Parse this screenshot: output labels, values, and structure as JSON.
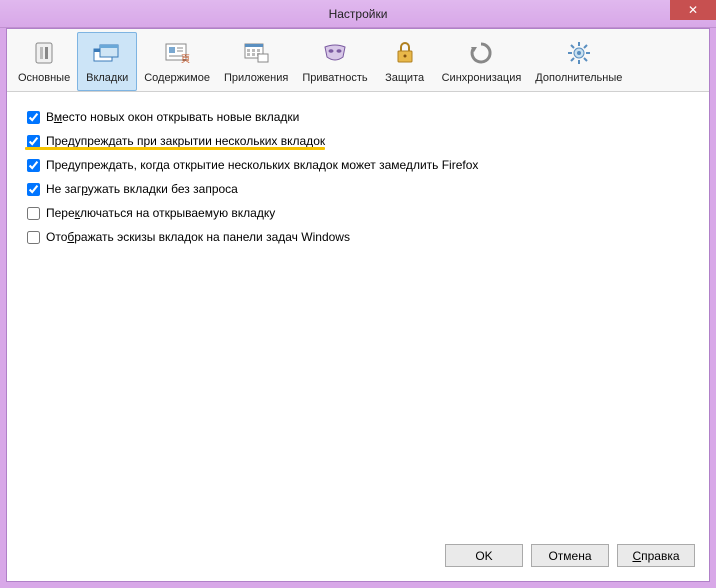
{
  "window": {
    "title": "Настройки",
    "close": "✕"
  },
  "toolbar": {
    "items": [
      {
        "id": "general",
        "label": "Основные"
      },
      {
        "id": "tabs",
        "label": "Вкладки"
      },
      {
        "id": "content",
        "label": "Содержимое"
      },
      {
        "id": "applications",
        "label": "Приложения"
      },
      {
        "id": "privacy",
        "label": "Приватность"
      },
      {
        "id": "security",
        "label": "Защита"
      },
      {
        "id": "sync",
        "label": "Синхронизация"
      },
      {
        "id": "advanced",
        "label": "Дополнительные"
      }
    ],
    "active": "tabs"
  },
  "options": [
    {
      "id": "open-new-tabs",
      "checked": true,
      "label": "Вместо новых окон открывать новые вкладки",
      "underline_index": 1
    },
    {
      "id": "warn-close-multiple",
      "checked": true,
      "label": "Предупреждать при закрытии нескольких вкладок",
      "highlighted": true
    },
    {
      "id": "warn-open-many",
      "checked": true,
      "label": "Предупреждать, когда открытие нескольких вкладок может замедлить Firefox"
    },
    {
      "id": "dont-load",
      "checked": true,
      "label": "Не загружать вкладки без запроса",
      "underline_index": 6
    },
    {
      "id": "switch-to-new",
      "checked": false,
      "label": "Переключаться на открываемую вкладку",
      "underline_index": 4
    },
    {
      "id": "show-previews",
      "checked": false,
      "label": "Отображать эскизы вкладок на панели задач Windows",
      "underline_index": 3
    }
  ],
  "buttons": {
    "ok": "OK",
    "cancel": "Отмена",
    "help": "Справка"
  }
}
